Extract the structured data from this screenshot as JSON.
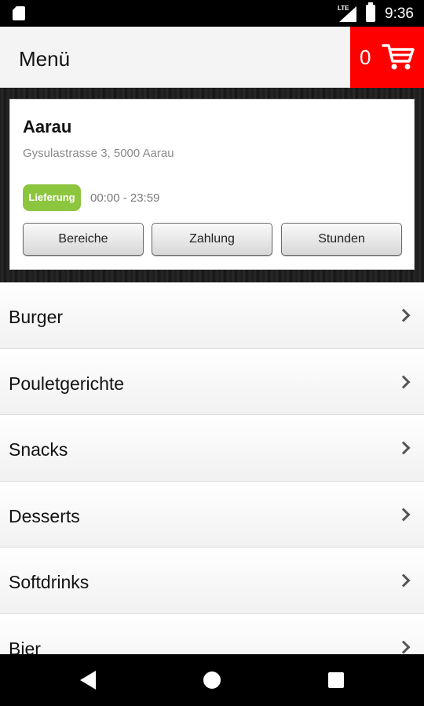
{
  "status_bar": {
    "network": "LTE",
    "time": "9:36"
  },
  "header": {
    "title": "Menü",
    "cart_count": "0"
  },
  "store": {
    "name": "Aarau",
    "address": "Gysulastrasse 3, 5000 Aarau",
    "badge": "Lieferung",
    "hours": "00:00 - 23:59",
    "buttons": [
      "Bereiche",
      "Zahlung",
      "Stunden"
    ]
  },
  "menu": {
    "items": [
      "Burger",
      "Pouletgerichte",
      "Snacks",
      "Desserts",
      "Softdrinks",
      "Bier"
    ]
  },
  "colors": {
    "accent": "#ff0000",
    "badge": "#8cc63f"
  },
  "icons": [
    "sd-card-icon",
    "signal-icon",
    "battery-icon",
    "cart-icon",
    "chevron-right-icon",
    "back-icon",
    "home-icon",
    "recents-icon"
  ]
}
